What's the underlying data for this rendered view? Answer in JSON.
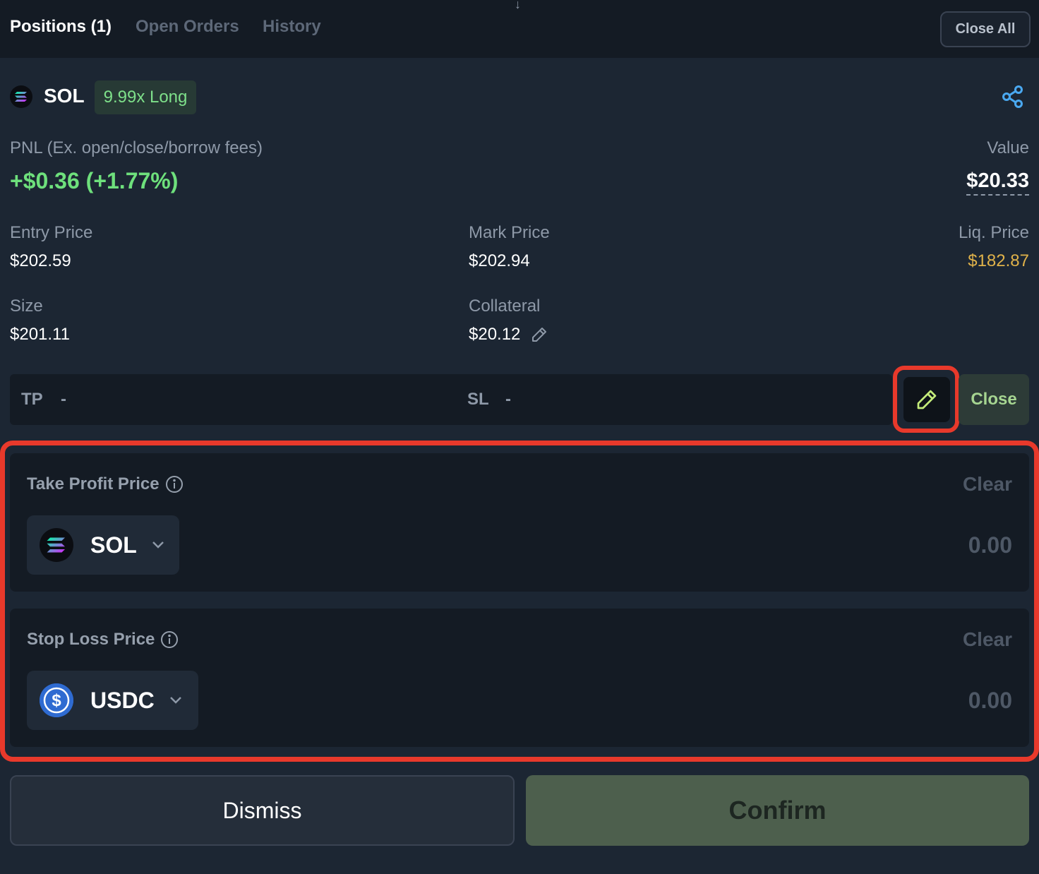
{
  "tabs": {
    "positions": "Positions (1)",
    "open_orders": "Open Orders",
    "history": "History"
  },
  "close_all_label": "Close All",
  "position": {
    "symbol": "SOL",
    "badge": "9.99x Long",
    "pnl_label": "PNL (Ex. open/close/borrow fees)",
    "pnl_value": "+$0.36 (+1.77%)",
    "value_label": "Value",
    "value_amount": "$20.33",
    "entry_price_label": "Entry Price",
    "entry_price": "$202.59",
    "mark_price_label": "Mark Price",
    "mark_price": "$202.94",
    "liq_price_label": "Liq. Price",
    "liq_price": "$182.87",
    "size_label": "Size",
    "size": "$201.11",
    "collateral_label": "Collateral",
    "collateral": "$20.12"
  },
  "tpsl": {
    "tp_label": "TP",
    "tp_value": "-",
    "sl_label": "SL",
    "sl_value": "-",
    "close_label": "Close"
  },
  "take_profit": {
    "label": "Take Profit Price",
    "clear_label": "Clear",
    "token": "SOL",
    "placeholder": "0.00"
  },
  "stop_loss": {
    "label": "Stop Loss Price",
    "clear_label": "Clear",
    "token": "USDC",
    "placeholder": "0.00"
  },
  "buttons": {
    "dismiss": "Dismiss",
    "confirm": "Confirm"
  },
  "colors": {
    "accent_green": "#6ee07c",
    "liq_price": "#e0b24a",
    "highlight_red": "#e8392b",
    "background": "#1c2633"
  },
  "icons": [
    "solana-icon",
    "share-icon",
    "pencil-icon",
    "info-icon",
    "chevron-down-icon",
    "usdc-icon",
    "arrow-down-icon"
  ]
}
